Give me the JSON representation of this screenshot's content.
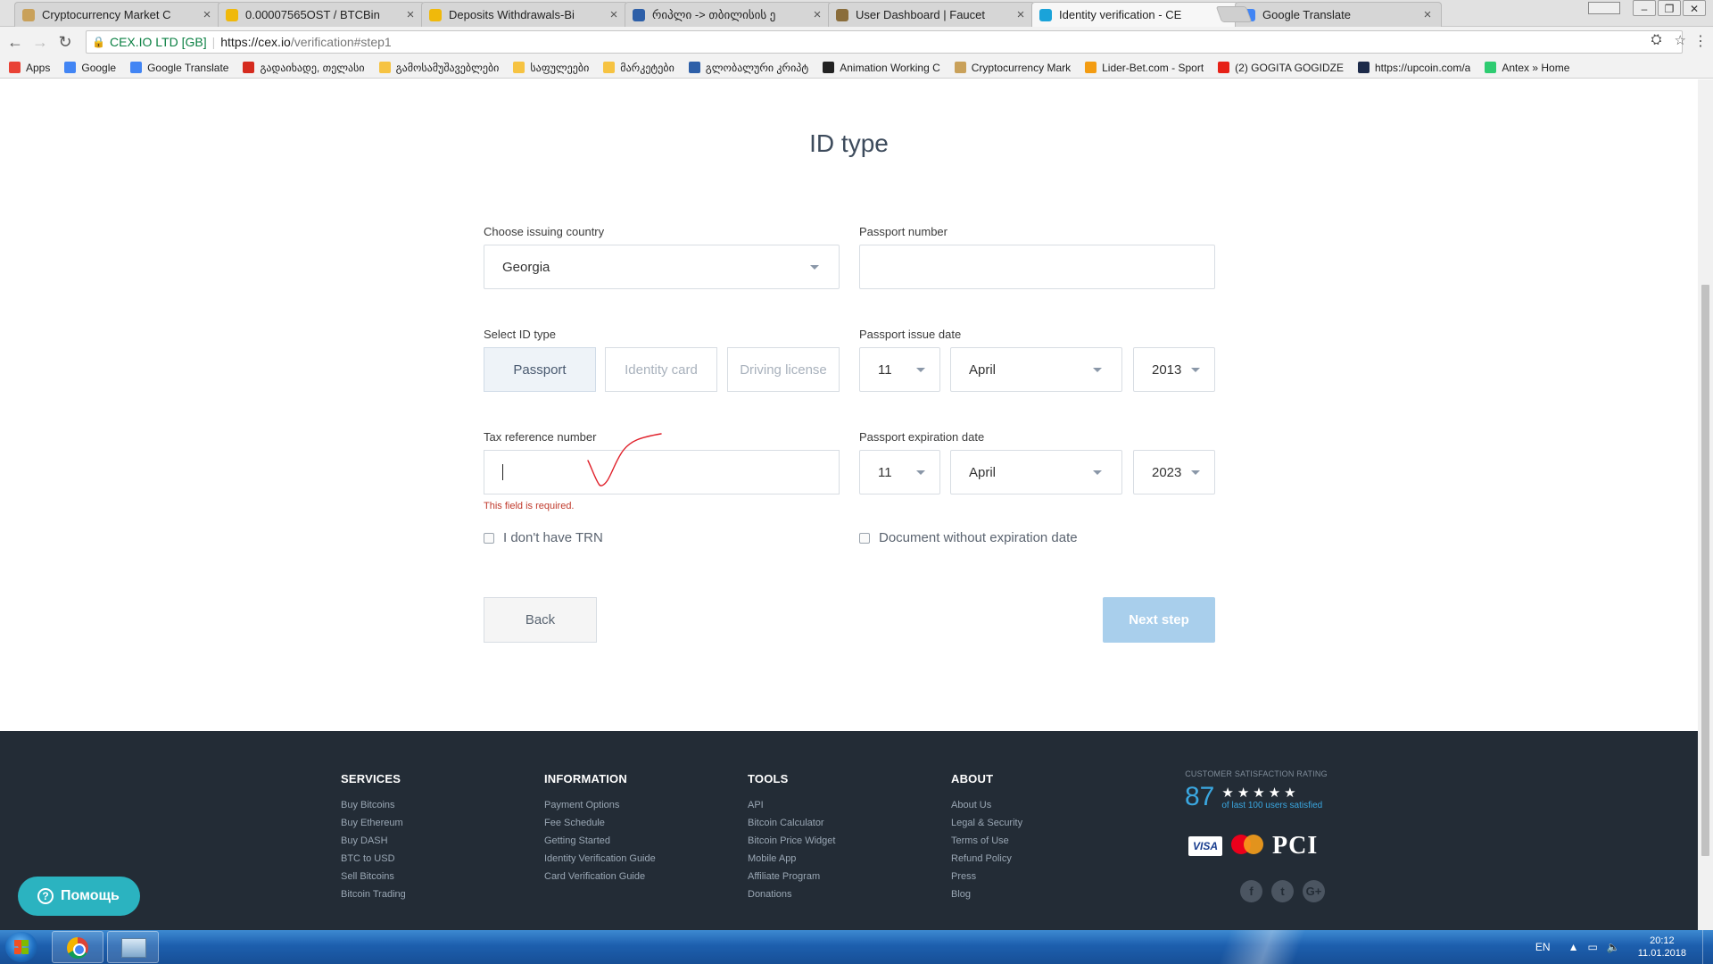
{
  "browser": {
    "tabs": [
      {
        "title": "Cryptocurrency Market C",
        "favicon_color": "#c9a15a",
        "active": false
      },
      {
        "title": "0.00007565OST / BTCBin",
        "favicon_color": "#f0b90b",
        "active": false
      },
      {
        "title": "Deposits Withdrawals-Bi",
        "favicon_color": "#f0b90b",
        "active": false
      },
      {
        "title": "რიპლი -> თბილისის ე",
        "favicon_color": "#2d5fa8",
        "active": false
      },
      {
        "title": "User Dashboard | Faucet",
        "favicon_color": "#8a6d3b",
        "active": false
      },
      {
        "title": "Identity verification - CE",
        "favicon_color": "#1aa3d9",
        "active": true
      },
      {
        "title": "Google Translate",
        "favicon_color": "#4285f4",
        "active": false
      }
    ],
    "site_name": "CEX.IO LTD [GB]",
    "url_host": "https://cex.io",
    "url_path": "/verification#step1",
    "bookmarks": [
      {
        "label": "Apps",
        "color": "#e94235"
      },
      {
        "label": "Google",
        "color": "#4285f4"
      },
      {
        "label": "Google Translate",
        "color": "#4285f4"
      },
      {
        "label": "გადაიხადე, თელასი",
        "color": "#d52b1e"
      },
      {
        "label": "გამოსამუშავებლები",
        "color": "#f6c342"
      },
      {
        "label": "საფულეები",
        "color": "#f6c342"
      },
      {
        "label": "მარკეტები",
        "color": "#f6c342"
      },
      {
        "label": "გლობალური კრიპტ",
        "color": "#2d5fa8"
      },
      {
        "label": "Animation Working C",
        "color": "#222222"
      },
      {
        "label": "Cryptocurrency Mark",
        "color": "#c9a15a"
      },
      {
        "label": "Lider-Bet.com - Sport",
        "color": "#f39c12"
      },
      {
        "label": "(2) GOGITA GOGIDZE",
        "color": "#e62117"
      },
      {
        "label": "https://upcoin.com/a",
        "color": "#1d2b4a"
      },
      {
        "label": "Antex » Home",
        "color": "#2ecc71"
      }
    ]
  },
  "form": {
    "heading": "ID type",
    "country_label": "Choose issuing country",
    "country_value": "Georgia",
    "passport_number_label": "Passport number",
    "passport_number_value": "",
    "id_type_label": "Select ID type",
    "id_types": [
      "Passport",
      "Identity card",
      "Driving license"
    ],
    "id_type_selected": "Passport",
    "issue_date_label": "Passport issue date",
    "issue_day": "11",
    "issue_month": "April",
    "issue_year": "2013",
    "tax_label": "Tax reference number",
    "tax_value": "",
    "tax_error": "This field is required.",
    "expiry_label": "Passport expiration date",
    "expiry_day": "11",
    "expiry_month": "April",
    "expiry_year": "2023",
    "no_trn_label": "I don't have TRN",
    "no_expiry_label": "Document without expiration date",
    "back_label": "Back",
    "next_label": "Next step",
    "colors": {
      "next_button": "#a9cfec",
      "error": "#c0392b",
      "annotation": "#e0202a"
    }
  },
  "footer": {
    "columns": [
      {
        "title": "SERVICES",
        "links": [
          "Buy Bitcoins",
          "Buy Ethereum",
          "Buy DASH",
          "BTC to USD",
          "Sell Bitcoins",
          "Bitcoin Trading"
        ]
      },
      {
        "title": "INFORMATION",
        "links": [
          "Payment Options",
          "Fee Schedule",
          "Getting Started",
          "Identity Verification Guide",
          "Card Verification Guide"
        ]
      },
      {
        "title": "TOOLS",
        "links": [
          "API",
          "Bitcoin Calculator",
          "Bitcoin Price Widget",
          "Mobile App",
          "Affiliate Program",
          "Donations"
        ]
      },
      {
        "title": "ABOUT",
        "links": [
          "About Us",
          "Legal & Security",
          "Terms of Use",
          "Refund Policy",
          "Press",
          "Blog"
        ]
      }
    ],
    "rating_caption": "CUSTOMER SATISFACTION RATING",
    "rating_value": "87",
    "rating_stars": "★★★★★",
    "rating_text": "of last 100 users satisfied",
    "payments": [
      "VISA",
      "mastercard",
      "PCI"
    ],
    "social_icons": [
      "facebook-icon",
      "twitter-icon",
      "google-plus-icon"
    ]
  },
  "help_button": "Помощь",
  "taskbar": {
    "language": "EN",
    "time": "20:12",
    "date": "11.01.2018"
  }
}
